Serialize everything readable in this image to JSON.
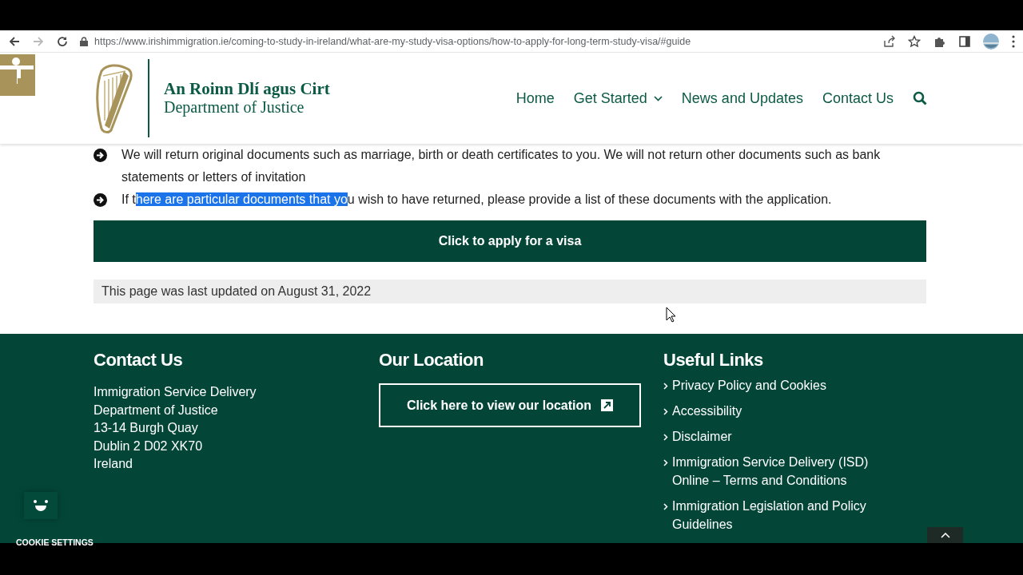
{
  "browser": {
    "url": "https://www.irishimmigration.ie/coming-to-study-in-ireland/what-are-my-study-visa-options/how-to-apply-for-long-term-study-visa/#guide",
    "forward_disabled": true
  },
  "header": {
    "title_irish": "An Roinn Dlí agus Cirt",
    "title_english": "Department of Justice",
    "nav": [
      {
        "label": "Home",
        "kind": "link"
      },
      {
        "label": "Get Started",
        "kind": "dropdown"
      },
      {
        "label": "News and Updates",
        "kind": "link"
      },
      {
        "label": "Contact Us",
        "kind": "link"
      }
    ]
  },
  "content": {
    "bullets": [
      {
        "text": "We will return original documents such as marriage, birth or death certificates to you. We will not return other documents such as bank statements or letters of invitation"
      },
      {
        "text_before": "If t",
        "selected_text": "here are particular documents that yo",
        "text_after": "u wish to have returned, please provide a list of these documents with the application."
      }
    ],
    "apply_button": "Click to apply for a visa",
    "last_updated": "This page was last updated on August 31, 2022"
  },
  "footer": {
    "contact": {
      "heading": "Contact Us",
      "lines": [
        "Immigration Service Delivery",
        "Department of Justice",
        "13-14 Burgh Quay",
        "Dublin 2 D02 XK70",
        "Ireland"
      ]
    },
    "location": {
      "heading": "Our Location",
      "button": "Click here to view our location"
    },
    "links": {
      "heading": "Useful Links",
      "items": [
        "Privacy Policy and Cookies",
        "Accessibility",
        "Disclaimer",
        "Immigration Service Delivery (ISD) Online – Terms and Conditions",
        "Immigration Legislation and Policy Guidelines"
      ]
    }
  },
  "cookie_settings": "COOKIE SETTINGS"
}
